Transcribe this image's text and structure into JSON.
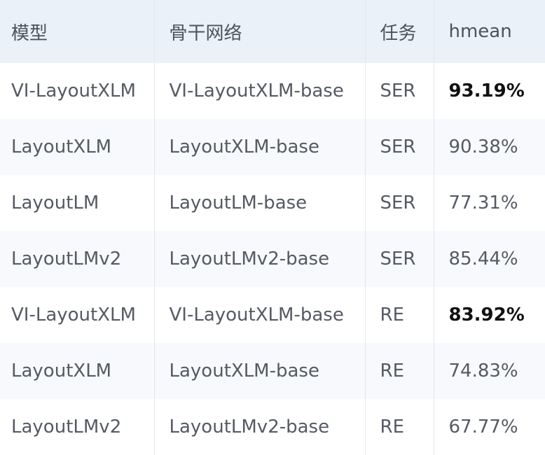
{
  "table": {
    "headers": {
      "model": "模型",
      "backbone": "骨干网络",
      "task": "任务",
      "hmean": "hmean"
    },
    "rows": [
      {
        "model": "VI-LayoutXLM",
        "backbone": "VI-LayoutXLM-base",
        "task": "SER",
        "hmean": "93.19%"
      },
      {
        "model": "LayoutXLM",
        "backbone": "LayoutXLM-base",
        "task": "SER",
        "hmean": "90.38%"
      },
      {
        "model": "LayoutLM",
        "backbone": "LayoutLM-base",
        "task": "SER",
        "hmean": "77.31%"
      },
      {
        "model": "LayoutLMv2",
        "backbone": "LayoutLMv2-base",
        "task": "SER",
        "hmean": "85.44%"
      },
      {
        "model": "VI-LayoutXLM",
        "backbone": "VI-LayoutXLM-base",
        "task": "RE",
        "hmean": "83.92%"
      },
      {
        "model": "LayoutXLM",
        "backbone": "LayoutXLM-base",
        "task": "RE",
        "hmean": "74.83%"
      },
      {
        "model": "LayoutLMv2",
        "backbone": "LayoutLMv2-base",
        "task": "RE",
        "hmean": "67.77%"
      }
    ]
  },
  "colors": {
    "header_bg": "#eaf1f9",
    "row_alt_bg": "#f7f9fc",
    "text": "#555a63",
    "emphasis": "#111111"
  }
}
